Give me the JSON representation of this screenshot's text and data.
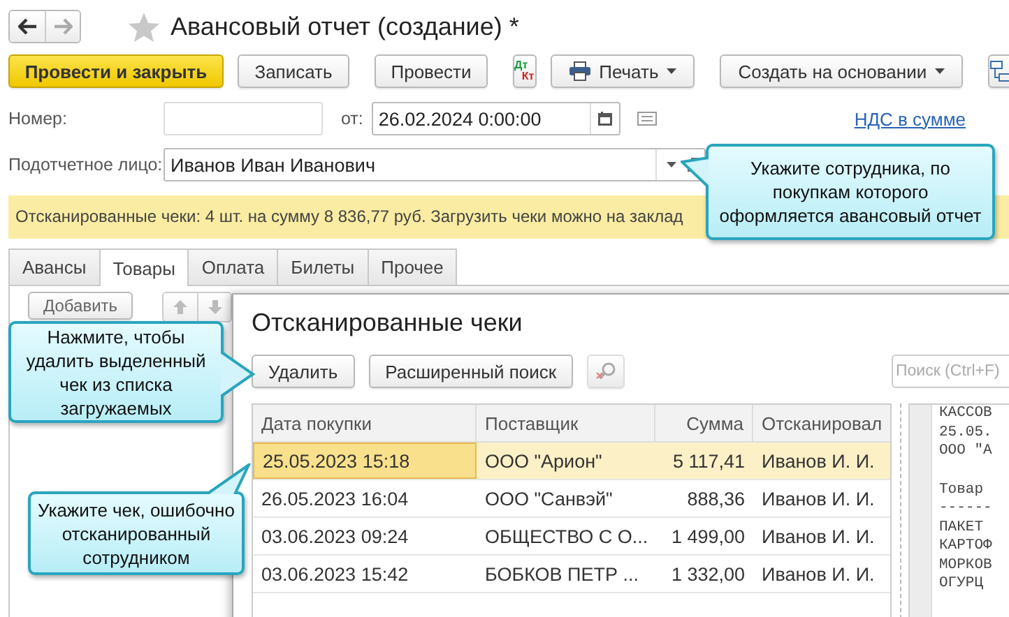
{
  "window": {
    "title": "Авансовый отчет (создание) *"
  },
  "toolbar": [
    {
      "kind": "primary",
      "label": "Провести и закрыть"
    },
    {
      "kind": "button",
      "label": "Записать"
    },
    {
      "kind": "button",
      "label": "Провести"
    },
    {
      "kind": "dtkt",
      "debit": "Дт",
      "credit": "Кт"
    },
    {
      "kind": "print",
      "label": "Печать"
    },
    {
      "kind": "menu",
      "label": "Создать на основании"
    },
    {
      "kind": "structure"
    }
  ],
  "number": {
    "label": "Номер:"
  },
  "date": {
    "label": "от:",
    "value": "26.02.2024  0:00:00"
  },
  "vat_link": "НДС в сумме",
  "person": {
    "label": "Подотчетное лицо:",
    "value": "Иванов Иван Иванович"
  },
  "notice": "Отсканированные чеки: 4 шт. на сумму 8 836,77 руб. Загрузить чеки можно на заклад",
  "tabs": [
    {
      "label": "Авансы",
      "selected": false
    },
    {
      "label": "Товары",
      "selected": true
    },
    {
      "label": "Оплата",
      "selected": false
    },
    {
      "label": "Билеты",
      "selected": false
    },
    {
      "label": "Прочее",
      "selected": false
    }
  ],
  "tab_buttons": {
    "add": "Добавить"
  },
  "dialog": {
    "title": "Отсканированные чеки",
    "buttons": [
      "Удалить",
      "Расширенный поиск"
    ],
    "search": {
      "placeholder": "Поиск (Ctrl+F)"
    },
    "columns": [
      "Дата покупки",
      "Поставщик",
      "Сумма",
      "Отсканировал"
    ],
    "rows": [
      {
        "date": "25.05.2023 15:18",
        "supplier": "ООО \"Арион\"",
        "sum": "5 117,41",
        "scanned_by": "Иванов И. И.",
        "selected": true
      },
      {
        "date": "26.05.2023 16:04",
        "supplier": "ООО \"Санвэй\"",
        "sum": "888,36",
        "scanned_by": "Иванов И. И.",
        "selected": false
      },
      {
        "date": "03.06.2023 09:24",
        "supplier": "ОБЩЕСТВО С О...",
        "sum": "1 499,00",
        "scanned_by": "Иванов И. И.",
        "selected": false
      },
      {
        "date": "03.06.2023 15:42",
        "supplier": "БОБКОВ ПЕТР ...",
        "sum": "1 332,00",
        "scanned_by": "Иванов И. И.",
        "selected": false
      }
    ],
    "receipt_preview": [
      [
        "КАССОВ",
        "25.05.",
        "ООО \"А"
      ],
      [
        "Товар",
        "------",
        "ПАКЕТ",
        "КАРТОФ",
        "МОРКОВ",
        "ОГУРЦ"
      ]
    ]
  },
  "callouts": [
    {
      "text": "Укажите сотрудника, по покупкам которого оформляется авансовый отчет"
    },
    {
      "text": "Нажмите, чтобы удалить выделенный чек из списка загружаемых"
    },
    {
      "text": "Укажите чек, ошибочно отсканированный сотрудником"
    }
  ]
}
